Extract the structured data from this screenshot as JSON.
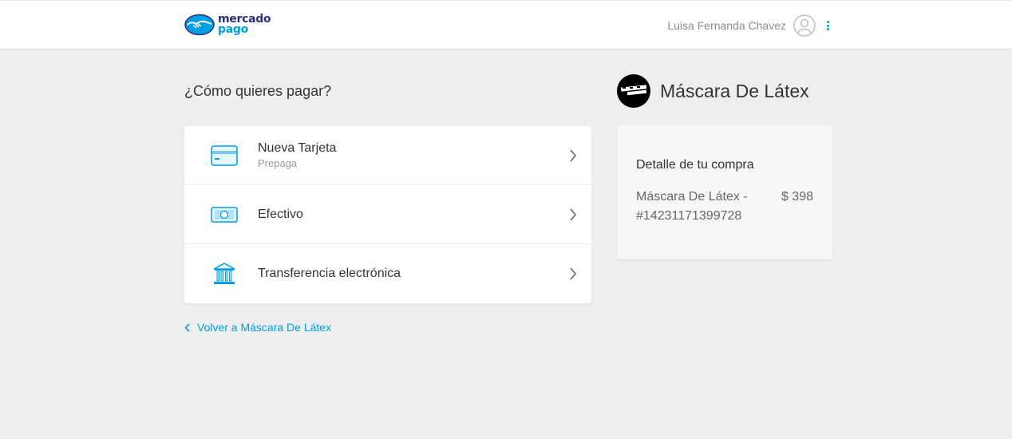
{
  "header": {
    "logo_line1": "mercado",
    "logo_line2": "pago",
    "user_name": "Luisa Fernanda Chavez",
    "avatar_icon": "user-avatar-icon",
    "menu_icon": "kebab-menu-icon"
  },
  "main": {
    "title": "¿Cómo quieres pagar?",
    "options": [
      {
        "label": "Nueva Tarjeta",
        "sublabel": "Prepaga",
        "icon": "credit-card-icon"
      },
      {
        "label": "Efectivo",
        "icon": "cash-icon"
      },
      {
        "label": "Transferencia electrónica",
        "icon": "bank-icon"
      }
    ],
    "back_link": "Volver a Máscara De Látex"
  },
  "sidebar": {
    "product_title": "Máscara De Látex",
    "summary_title": "Detalle de tu compra",
    "item_line1": "Máscara De Látex -",
    "item_line2": "#14231171399728",
    "item_price": "$ 398"
  },
  "colors": {
    "accent": "#009ee3",
    "brand_dark": "#2d3277",
    "background": "#eeeeee"
  }
}
